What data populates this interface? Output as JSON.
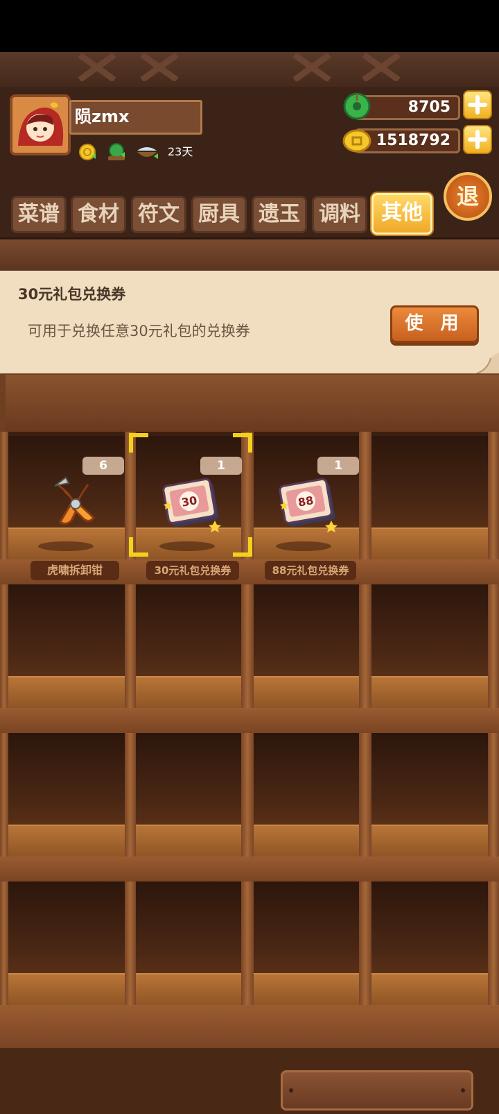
{
  "player": {
    "name": "陨zmx",
    "days": "23天"
  },
  "resources": {
    "jade": "8705",
    "coins": "1518792"
  },
  "exit_label": "退",
  "tabs": [
    {
      "label": "菜谱",
      "active": false
    },
    {
      "label": "食材",
      "active": false
    },
    {
      "label": "符文",
      "active": false
    },
    {
      "label": "厨具",
      "active": false
    },
    {
      "label": "遗玉",
      "active": false
    },
    {
      "label": "调料",
      "active": false
    },
    {
      "label": "其他",
      "active": true
    }
  ],
  "selected_item": {
    "title": "30元礼包兑换券",
    "description": "可用于兑换任意30元礼包的兑换券",
    "use_label": "使 用"
  },
  "items": [
    {
      "name": "虎啸拆卸钳",
      "count": "6",
      "icon": "pliers-icon"
    },
    {
      "name": "30元礼包兑换券",
      "count": "1",
      "icon": "voucher-30-icon",
      "badge_text": "30"
    },
    {
      "name": "88元礼包兑换券",
      "count": "1",
      "icon": "voucher-88-icon",
      "badge_text": "88"
    }
  ],
  "colors": {
    "accent": "#f0b020",
    "selection": "#f2d21a",
    "panel": "#f1ddc0"
  }
}
